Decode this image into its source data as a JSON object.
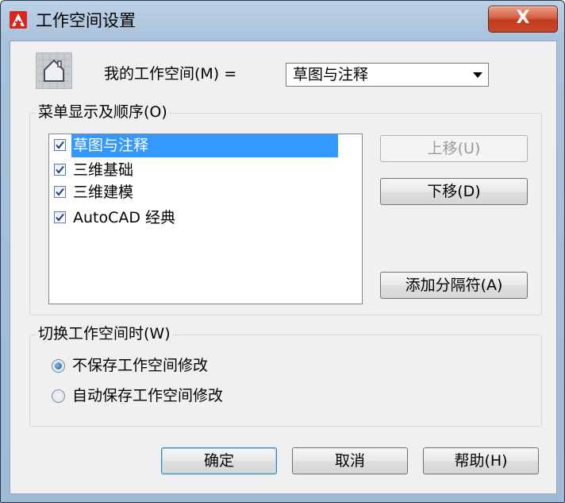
{
  "window": {
    "title": "工作空间设置",
    "close_label": "X"
  },
  "workspace": {
    "label": "我的工作空间(M) =",
    "selected": "草图与注释"
  },
  "menu_group": {
    "title": "菜单显示及顺序(O)",
    "items": [
      {
        "label": "草图与注释",
        "checked": true,
        "selected": true
      },
      {
        "label": "三维基础",
        "checked": true,
        "selected": false
      },
      {
        "label": "三维建模",
        "checked": true,
        "selected": false
      },
      {
        "label": "AutoCAD 经典",
        "checked": true,
        "selected": false
      }
    ],
    "move_up": "上移(U)",
    "move_down": "下移(D)",
    "add_separator": "添加分隔符(A)"
  },
  "switch_group": {
    "title": "切换工作空间时(W)",
    "options": [
      {
        "label": "不保存工作空间修改",
        "selected": true
      },
      {
        "label": "自动保存工作空间修改",
        "selected": false
      }
    ]
  },
  "buttons": {
    "ok": "确定",
    "cancel": "取消",
    "help": "帮助(H)"
  },
  "colors": {
    "title_bar": "#a9c2dc",
    "selection": "#3399ff",
    "close_button": "#c8472a"
  },
  "icons": {
    "app": "autocad-logo-icon",
    "workspace": "house-icon",
    "close": "close-icon"
  }
}
